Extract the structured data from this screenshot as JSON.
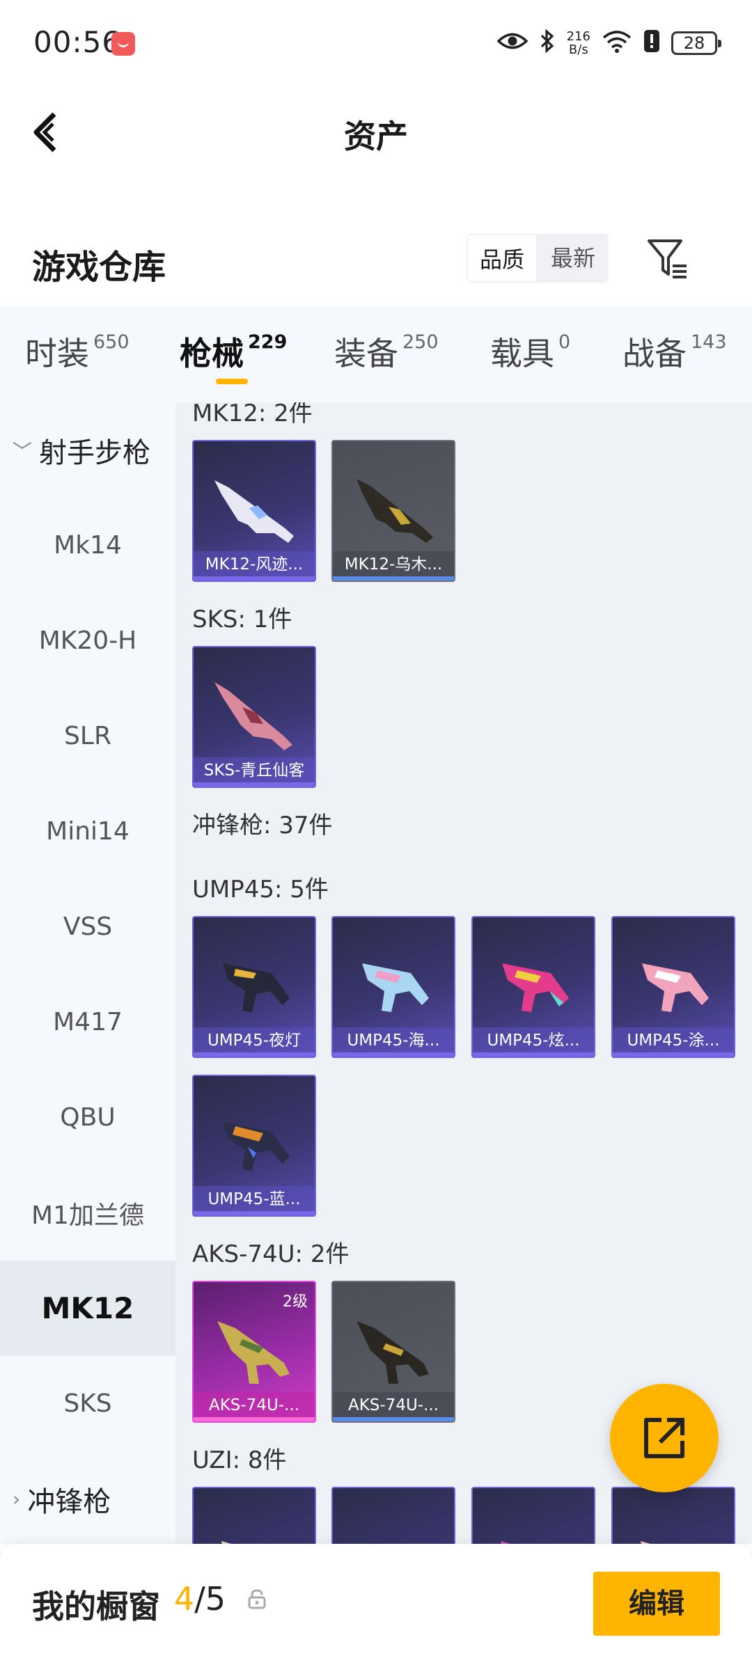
{
  "status_bar": {
    "time": "00:56",
    "net_speed_value": "216",
    "net_speed_unit": "B/s",
    "battery": "28",
    "icons": [
      "eye-icon",
      "bluetooth-icon",
      "wifi-icon",
      "alert-icon",
      "battery-icon"
    ]
  },
  "header": {
    "title": "资产"
  },
  "section": {
    "title": "游戏仓库",
    "sort_options": [
      "品质",
      "最新"
    ],
    "selected_sort": "品质"
  },
  "tabs": [
    {
      "label": "时装",
      "count": "650"
    },
    {
      "label": "枪械",
      "count": "229",
      "active": true
    },
    {
      "label": "装备",
      "count": "250"
    },
    {
      "label": "载具",
      "count": "0"
    },
    {
      "label": "战备",
      "count": "143"
    }
  ],
  "sidebar": {
    "items": [
      {
        "label": "射手步枪",
        "type": "group",
        "expanded": true
      },
      {
        "label": "Mk14"
      },
      {
        "label": "MK20-H"
      },
      {
        "label": "SLR"
      },
      {
        "label": "Mini14"
      },
      {
        "label": "VSS"
      },
      {
        "label": "M417"
      },
      {
        "label": "QBU"
      },
      {
        "label": "M1加兰德"
      },
      {
        "label": "MK12",
        "selected": true
      },
      {
        "label": "SKS"
      },
      {
        "label": "冲锋枪",
        "type": "group",
        "expanded": false
      }
    ]
  },
  "content": {
    "groups": [
      {
        "label": "MK12: 2件",
        "items": [
          {
            "name": "MK12-风迹...",
            "rarity": "purple"
          },
          {
            "name": "MK12-乌木...",
            "rarity": "grey"
          }
        ]
      },
      {
        "label": "SKS: 1件",
        "items": [
          {
            "name": "SKS-青丘仙客",
            "rarity": "purple"
          }
        ]
      },
      {
        "label": "冲锋枪: 37件",
        "items": []
      },
      {
        "label": "UMP45: 5件",
        "items": [
          {
            "name": "UMP45-夜灯",
            "rarity": "purple"
          },
          {
            "name": "UMP45-海...",
            "rarity": "purple"
          },
          {
            "name": "UMP45-炫...",
            "rarity": "purple"
          },
          {
            "name": "UMP45-涂...",
            "rarity": "purple"
          },
          {
            "name": "UMP45-蓝...",
            "rarity": "purple"
          }
        ]
      },
      {
        "label": "AKS-74U: 2件",
        "items": [
          {
            "name": "AKS-74U-...",
            "rarity": "pink",
            "level": "2级"
          },
          {
            "name": "AKS-74U-...",
            "rarity": "grey"
          }
        ]
      },
      {
        "label": "UZI: 8件",
        "items": [
          {
            "name": "",
            "rarity": "purple"
          },
          {
            "name": "",
            "rarity": "purple"
          },
          {
            "name": "",
            "rarity": "purple"
          },
          {
            "name": "",
            "rarity": "purple"
          }
        ]
      }
    ]
  },
  "bottom_bar": {
    "label": "我的橱窗",
    "count_current": "4",
    "count_separator": "/",
    "count_total": "5",
    "edit_label": "编辑"
  },
  "colors": {
    "accent": "#ffb400",
    "sidebar_bg": "#f5f8fc",
    "content_bg": "#eef1f6",
    "rarity_purple": "#6c63d8",
    "rarity_grey": "#5b5d66",
    "rarity_pink": "#d13fc4"
  }
}
